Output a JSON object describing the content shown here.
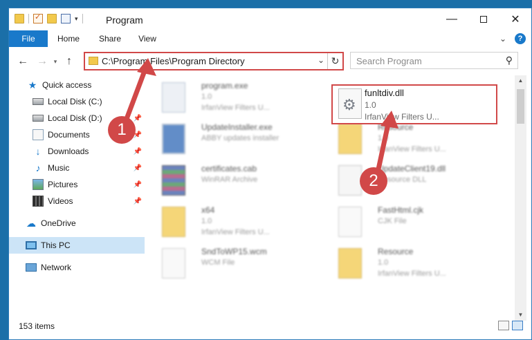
{
  "window": {
    "title": "Program",
    "min_label": "—",
    "close_label": "✕"
  },
  "ribbon": {
    "tabs": [
      "File",
      "Home",
      "Share",
      "View"
    ],
    "expand_label": "⌄",
    "help_label": "?"
  },
  "address": {
    "path": "C:\\Program Files\\Program Directory",
    "search_placeholder": "Search Program"
  },
  "nav": {
    "items": [
      {
        "label": "Quick access",
        "icon": "star-icon"
      },
      {
        "label": "Local Disk (C:)",
        "icon": "drive-icon"
      },
      {
        "label": "Local Disk (D:)",
        "icon": "drive-icon"
      },
      {
        "label": "Documents",
        "icon": "documents-icon"
      },
      {
        "label": "Downloads",
        "icon": "downloads-icon"
      },
      {
        "label": "Music",
        "icon": "music-icon"
      },
      {
        "label": "Pictures",
        "icon": "pictures-icon"
      },
      {
        "label": "Videos",
        "icon": "videos-icon"
      },
      {
        "label": "OneDrive",
        "icon": "cloud-icon"
      },
      {
        "label": "This PC",
        "icon": "computer-icon"
      },
      {
        "label": "Network",
        "icon": "network-icon"
      }
    ]
  },
  "files": [
    {
      "name": "program.exe",
      "line1": "1.0",
      "line2": "IrfanView Filters U..."
    },
    {
      "name": "UpdateInstaller.exe",
      "line1": "ABBY updates installer",
      "line2": ""
    },
    {
      "name": "certificates.cab",
      "line1": "WinRAR Archive",
      "line2": ""
    },
    {
      "name": "x64",
      "line1": "1.0",
      "line2": "IrfanView Filters U..."
    },
    {
      "name": "SndToWP15.wcm",
      "line1": "WCM File",
      "line2": ""
    },
    {
      "name": "Resource",
      "line1": "1.0",
      "line2": "IrfanView Filters U..."
    },
    {
      "name": "UpdateClient19.dll",
      "line1": "Resource DLL",
      "line2": ""
    },
    {
      "name": "FastHtml.cjk",
      "line1": "CJK File",
      "line2": ""
    },
    {
      "name": "Resource",
      "line1": "1.0",
      "line2": "IrfanView Filters U..."
    }
  ],
  "highlighted_file": {
    "name": "funltdiv.dll",
    "line1": "1.0",
    "line2": "IrfanView Filters U..."
  },
  "callouts": {
    "step1": "1",
    "step2": "2"
  },
  "status": {
    "item_count": "153 items"
  },
  "colors": {
    "accent": "#1979ca",
    "callout": "#d14848"
  }
}
